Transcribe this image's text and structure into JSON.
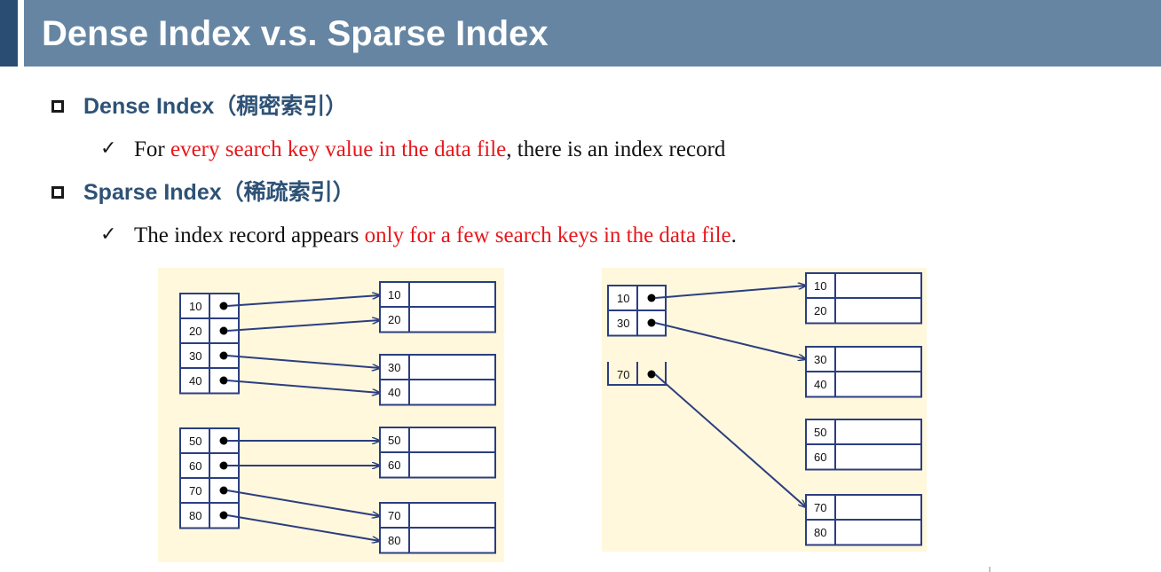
{
  "slide": {
    "title": "Dense Index v.s. Sparse Index"
  },
  "bullets": [
    {
      "heading": "Dense Index（稠密索引）",
      "sub_prefix": "For ",
      "sub_highlight": "every search key value in the data file",
      "sub_suffix": ", there is an index record"
    },
    {
      "heading": "Sparse Index（稀疏索引）",
      "sub_prefix": "The index record appears ",
      "sub_highlight": "only for a few search keys in the data file",
      "sub_suffix": "."
    }
  ],
  "dense_diagram": {
    "index_keys": [
      "10",
      "20",
      "30",
      "40",
      "50",
      "60",
      "70",
      "80"
    ],
    "data_keys": [
      "10",
      "20",
      "30",
      "40",
      "50",
      "60",
      "70",
      "80"
    ]
  },
  "sparse_diagram": {
    "index_keys": [
      "10",
      "30",
      "70"
    ],
    "data_keys": [
      "10",
      "20",
      "30",
      "40",
      "50",
      "60",
      "70",
      "80"
    ]
  },
  "colors": {
    "title_bar": "#6585a3",
    "highlight": "#e8171b",
    "heading": "#2e5276",
    "diagram_bg": "#fff8dc",
    "arrow": "#2c3e80"
  }
}
